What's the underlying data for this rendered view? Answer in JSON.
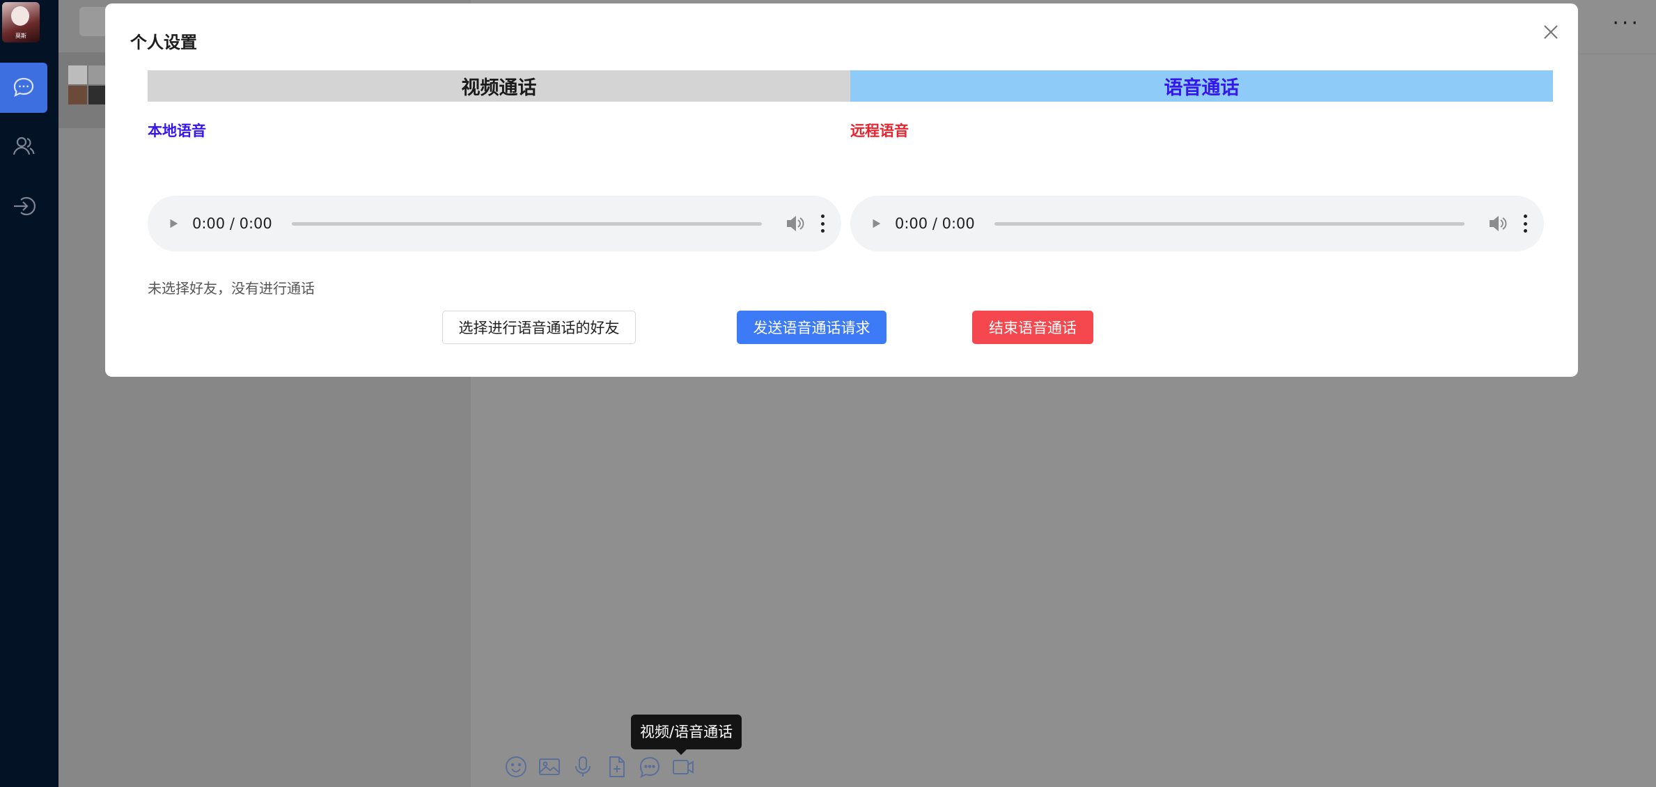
{
  "nav": {
    "avatar_caption": "莫斯",
    "items": [
      "chat-icon",
      "contacts-icon",
      "logout-icon"
    ]
  },
  "chat": {
    "more_label": "···"
  },
  "toolbar": {
    "icons": [
      "emoji-icon",
      "image-icon",
      "microphone-icon",
      "file-icon",
      "message-icon",
      "video-call-icon"
    ]
  },
  "tooltip": {
    "text": "视频/语音通话"
  },
  "modal": {
    "title": "个人设置",
    "tabs": [
      {
        "label": "视频通话",
        "active": false
      },
      {
        "label": "语音通话",
        "active": true
      }
    ],
    "local_label": "本地语音",
    "remote_label": "远程语音",
    "local_player": {
      "time": "0:00 / 0:00",
      "progress": 0
    },
    "remote_player": {
      "time": "0:00 / 0:00",
      "progress": 0
    },
    "status_text": "未选择好友，没有进行通话",
    "buttons": {
      "select_friend": "选择进行语音通话的好友",
      "send_request": "发送语音通话请求",
      "end_call": "结束语音通话"
    }
  },
  "colors": {
    "nav_bg": "#031225",
    "nav_active": "#3d6fe0",
    "local_label": "#3515f0",
    "remote_label": "#e8232d",
    "voice_tab_bg": "#8fcbf8",
    "video_tab_bg": "#d4d4d4",
    "send_button": "#3d7af5",
    "end_button": "#f5484e"
  }
}
